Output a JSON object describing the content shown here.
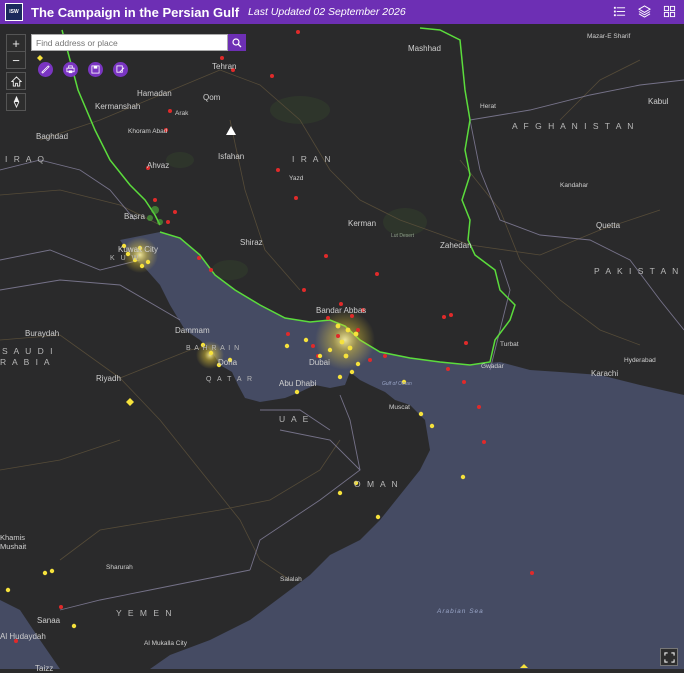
{
  "header": {
    "logo_text": "ISW",
    "title": "The Campaign in the Persian Gulf",
    "updated": "Last Updated 02 September 2026"
  },
  "search": {
    "placeholder": "Find address or place"
  },
  "zoom": {
    "in": "+",
    "out": "−"
  },
  "icons": [
    "list-icon",
    "layers-icon",
    "grid-icon",
    "home-icon",
    "compass-icon",
    "search-icon",
    "measure-icon",
    "print-icon",
    "save-icon",
    "edit-icon",
    "fullscreen-icon"
  ],
  "countries": [
    {
      "id": "iran",
      "text": "I R A N"
    },
    {
      "id": "iraq",
      "text": "I R A Q"
    },
    {
      "id": "afghanistan",
      "text": "A F G H A N I S T A N"
    },
    {
      "id": "pakistan",
      "text": "P A K I S T A N"
    },
    {
      "id": "saudi",
      "text": "S A U D I"
    },
    {
      "id": "arabia",
      "text": "R A B I A"
    },
    {
      "id": "qatar",
      "text": "Q A T A R"
    },
    {
      "id": "bahrain",
      "text": "B A H R A I N"
    },
    {
      "id": "kuwait",
      "text": "K U W"
    },
    {
      "id": "uae",
      "text": "U A E"
    },
    {
      "id": "oman",
      "text": "O M A N"
    },
    {
      "id": "yemen",
      "text": "Y E M E N"
    }
  ],
  "cities": [
    {
      "id": "mashhad",
      "text": "Mashhad"
    },
    {
      "id": "mazar",
      "text": "Mazar-E Sharif"
    },
    {
      "id": "tehran",
      "text": "Tehran"
    },
    {
      "id": "qom",
      "text": "Qom"
    },
    {
      "id": "hamadan",
      "text": "Hamadan"
    },
    {
      "id": "kermanshah",
      "text": "Kermanshah"
    },
    {
      "id": "arak",
      "text": "Arak"
    },
    {
      "id": "khoram",
      "text": "Khoram Abad"
    },
    {
      "id": "isfahan",
      "text": "Isfahan"
    },
    {
      "id": "yazd",
      "text": "Yazd"
    },
    {
      "id": "herat",
      "text": "Herat"
    },
    {
      "id": "kabul",
      "text": "Kabul"
    },
    {
      "id": "baghdad",
      "text": "Baghdad"
    },
    {
      "id": "ahvaz",
      "text": "Ahvaz"
    },
    {
      "id": "basra",
      "text": "Basra"
    },
    {
      "id": "kuwaitcity",
      "text": "Kuwait City"
    },
    {
      "id": "shiraz",
      "text": "Shiraz"
    },
    {
      "id": "kerman",
      "text": "Kerman"
    },
    {
      "id": "kandahar",
      "text": "Kandahar"
    },
    {
      "id": "quetta",
      "text": "Quetta"
    },
    {
      "id": "zahedan",
      "text": "Zahedan"
    },
    {
      "id": "bandarabbas",
      "text": "Bandar Abbas"
    },
    {
      "id": "buraydah",
      "text": "Buraydah"
    },
    {
      "id": "dammam",
      "text": "Dammam"
    },
    {
      "id": "doha",
      "text": "Doha"
    },
    {
      "id": "riyadh",
      "text": "Riyadh"
    },
    {
      "id": "abudhabi",
      "text": "Abu Dhabi"
    },
    {
      "id": "dubai",
      "text": "Dubai"
    },
    {
      "id": "muscat",
      "text": "Muscat"
    },
    {
      "id": "turbat",
      "text": "Turbat"
    },
    {
      "id": "gwadar",
      "text": "Gwadar"
    },
    {
      "id": "hyderabad",
      "text": "Hyderabad"
    },
    {
      "id": "karachi",
      "text": "Karachi"
    },
    {
      "id": "khamis",
      "text": "Khamis"
    },
    {
      "id": "mushait",
      "text": "Mushait"
    },
    {
      "id": "sharurah",
      "text": "Sharurah"
    },
    {
      "id": "salalah",
      "text": "Salalah"
    },
    {
      "id": "sanaa",
      "text": "Sanaa"
    },
    {
      "id": "hudaydah",
      "text": "Al Hudaydah"
    },
    {
      "id": "mukalla",
      "text": "Al Mukalla City"
    },
    {
      "id": "taizz",
      "text": "Taizz"
    },
    {
      "id": "lutdesert",
      "text": "Lut Desert"
    }
  ],
  "seas": [
    {
      "id": "arabiansea",
      "text": "Arabian Sea"
    },
    {
      "id": "gulfofoman",
      "text": "Gulf of Oman"
    }
  ],
  "colors": {
    "header": "#6d2fb4",
    "land": "#2a2a2b",
    "sea": "#454b63",
    "iran_border": "#5bdc3c",
    "red_marker": "#e02a2a",
    "yellow_marker": "#f6e23c"
  }
}
